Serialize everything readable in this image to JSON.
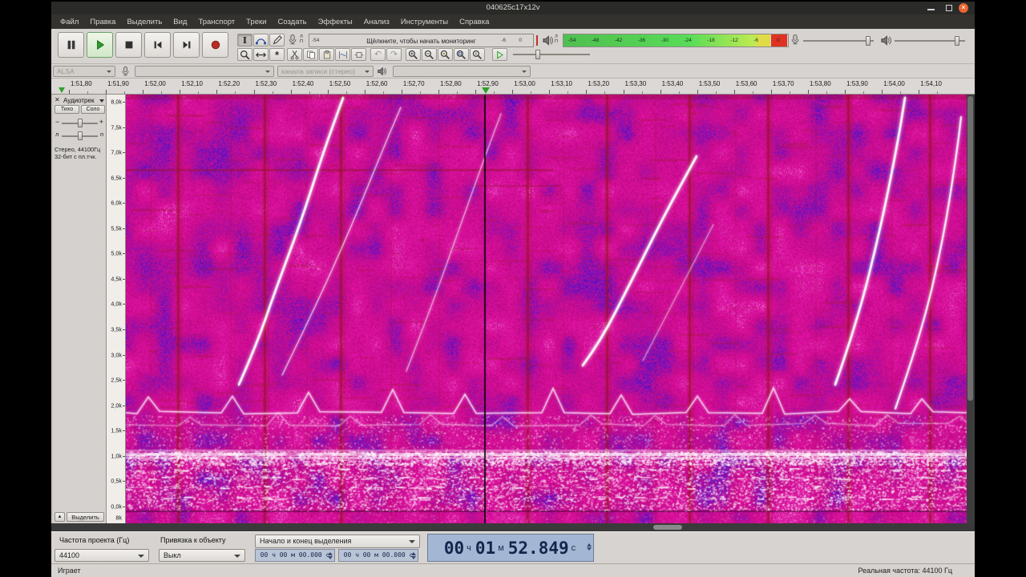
{
  "window": {
    "title": "040625c17x12v"
  },
  "menu": {
    "items": [
      "Файл",
      "Правка",
      "Выделить",
      "Вид",
      "Транспорт",
      "Треки",
      "Создать",
      "Эффекты",
      "Анализ",
      "Инструменты",
      "Справка"
    ]
  },
  "meters": {
    "record": {
      "channel_top": "Л",
      "channel_bottom": "П",
      "left_scale": "-54",
      "message": "Щёлкните, чтобы начать мониторинг",
      "scale_right": [
        "-6",
        "0"
      ]
    },
    "playback": {
      "channel_top": "Л",
      "channel_bottom": "П",
      "scale": [
        "-54",
        "-48",
        "-42",
        "-36",
        "-30",
        "-24",
        "-18",
        "-12",
        "-6",
        "0"
      ]
    }
  },
  "device_toolbar": {
    "host": "ALSA",
    "recording_device": "",
    "recording_channels": "канала записи (стерео)",
    "playback_device": ""
  },
  "timeline": {
    "labels": [
      "1:51,80",
      "1:51,90",
      "1:52,00",
      "1:52,10",
      "1:52,20",
      "1:52,30",
      "1:52,40",
      "1:52,50",
      "1:52,60",
      "1:52,70",
      "1:52,80",
      "1:52,90",
      "1:53,00",
      "1:53,10",
      "1:53,20",
      "1:53,30",
      "1:53,40",
      "1:53,50",
      "1:53,60",
      "1:53,70",
      "1:53,80",
      "1:53,90",
      "1:54,00",
      "1:54,10"
    ]
  },
  "track": {
    "close": "✕",
    "name": "Аудиотрек",
    "mute_label": "Тихо",
    "solo_label": "Соло",
    "gain_minus": "−",
    "gain_plus": "+",
    "pan_left": "л",
    "pan_right": "п",
    "info_line1": "Стерео, 44100Гц",
    "info_line2": "32-бит с пл.тчк.",
    "collapse": "▲",
    "select_label": "Выделить",
    "freq_labels": [
      "8,0k",
      "7,5k",
      "7,0k",
      "6,5k",
      "6,0k",
      "5,5k",
      "5,0k",
      "4,5k",
      "4,0k",
      "3,5k",
      "3,0k",
      "2,5k",
      "2,0k",
      "1,5k",
      "1,0k",
      "0,5k",
      "0,0k"
    ],
    "freq_label_next": "8k"
  },
  "selection_toolbar": {
    "rate_label": "Частота проекта (Гц)",
    "rate_value": "44100",
    "snap_label": "Привязка к объекту",
    "snap_value": "Выкл",
    "range_mode": "Начало и конец выделения",
    "selection_start": "00 ч 00 м 00.000 с",
    "selection_end": "00 ч 00 м 00.000 с",
    "position_parts": [
      {
        "value": "00",
        "unit": "ч"
      },
      {
        "value": "01",
        "unit": "м"
      },
      {
        "value": "52.849",
        "unit": "с"
      }
    ]
  },
  "status_bar": {
    "left": "Играет",
    "right": "Реальная частота: 44100 Гц"
  }
}
